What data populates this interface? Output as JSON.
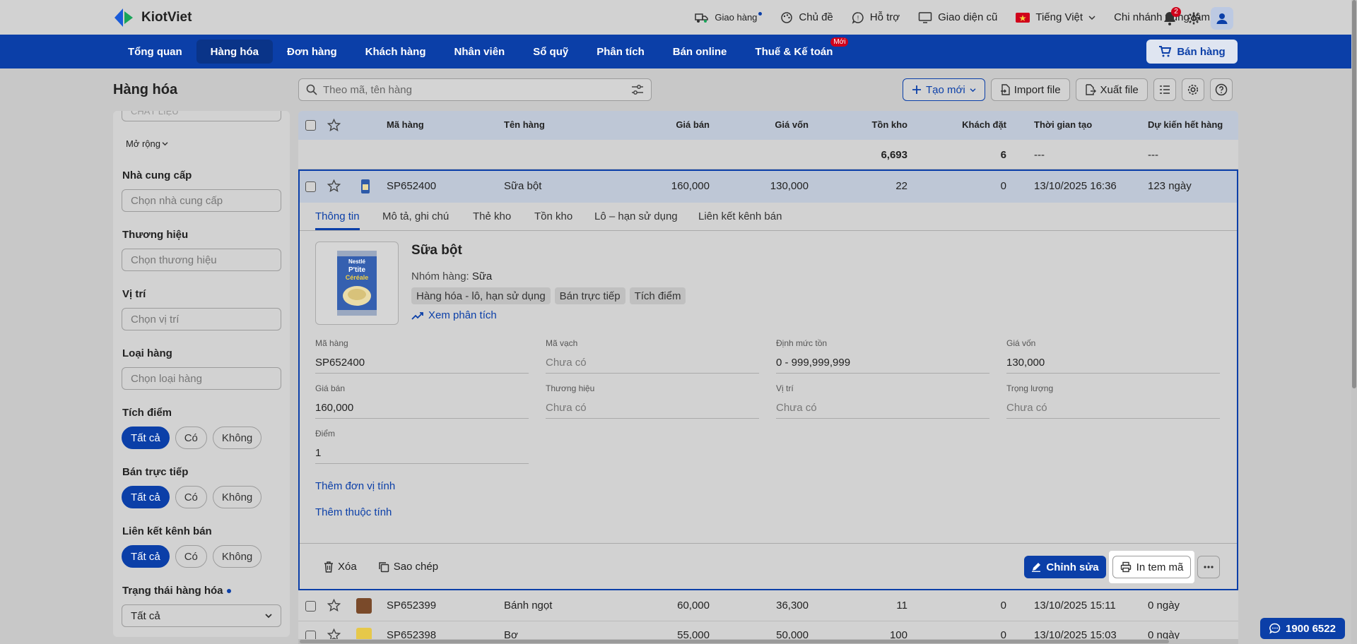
{
  "app": {
    "name": "KiotViet"
  },
  "topbar": {
    "delivery": "Giao hàng",
    "theme": "Chủ đề",
    "support": "Hỗ trợ",
    "old_ui": "Giao diện cũ",
    "language": "Tiếng Việt",
    "branch": "Chi nhánh trung tâm",
    "notif_count": "2"
  },
  "nav": {
    "items": [
      {
        "label": "Tổng quan"
      },
      {
        "label": "Hàng hóa"
      },
      {
        "label": "Đơn hàng"
      },
      {
        "label": "Khách hàng"
      },
      {
        "label": "Nhân viên"
      },
      {
        "label": "Sổ quỹ"
      },
      {
        "label": "Phân tích"
      },
      {
        "label": "Bán online"
      },
      {
        "label": "Thuế & Kế toán"
      }
    ],
    "new_badge": "Mới",
    "sell_button": "Bán hàng"
  },
  "page": {
    "title": "Hàng hóa"
  },
  "search": {
    "placeholder": "Theo mã, tên hàng"
  },
  "actions": {
    "create": "Tạo mới",
    "import": "Import file",
    "export": "Xuất file"
  },
  "sidebar": {
    "material_cut": "CHẤT LIỆU",
    "expand": "Mở rộng",
    "supplier_label": "Nhà cung cấp",
    "supplier_ph": "Chọn nhà cung cấp",
    "brand_label": "Thương hiệu",
    "brand_ph": "Chọn thương hiệu",
    "location_label": "Vị trí",
    "location_ph": "Chọn vị trí",
    "type_label": "Loại hàng",
    "type_ph": "Chọn loại hàng",
    "points_label": "Tích điểm",
    "direct_label": "Bán trực tiếp",
    "channel_label": "Liên kết kênh bán",
    "status_label": "Trạng thái hàng hóa",
    "status_value": "Tất cả",
    "chip_all": "Tất cả",
    "chip_yes": "Có",
    "chip_no": "Không"
  },
  "table": {
    "columns": [
      "Mã hàng",
      "Tên hàng",
      "Giá bán",
      "Giá vốn",
      "Tồn kho",
      "Khách đặt",
      "Thời gian tạo",
      "Dự kiến hết hàng"
    ],
    "summary": {
      "stock": "6,693",
      "ordered": "6",
      "created": "---",
      "eta": "---"
    },
    "rows": [
      {
        "code": "SP652400",
        "name": "Sữa bột",
        "price": "160,000",
        "cost": "130,000",
        "stock": "22",
        "ordered": "0",
        "created": "13/10/2025 16:36",
        "eta": "123 ngày"
      },
      {
        "code": "SP652399",
        "name": "Bánh ngọt",
        "price": "60,000",
        "cost": "36,300",
        "stock": "11",
        "ordered": "0",
        "created": "13/10/2025 15:11",
        "eta": "0 ngày"
      },
      {
        "code": "SP652398",
        "name": "Bơ",
        "price": "55,000",
        "cost": "50,000",
        "stock": "100",
        "ordered": "0",
        "created": "13/10/2025 15:03",
        "eta": "0 ngày"
      }
    ]
  },
  "detail": {
    "tabs": [
      "Thông tin",
      "Mô tả, ghi chú",
      "Thẻ kho",
      "Tồn kho",
      "Lô – hạn sử dụng",
      "Liên kết kênh bán"
    ],
    "name": "Sữa bột",
    "group_label": "Nhóm hàng:",
    "group_value": "Sữa",
    "tags": [
      "Hàng hóa - lô, hạn sử dụng",
      "Bán trực tiếp",
      "Tích điểm"
    ],
    "analysis_link": "Xem phân tích",
    "image_text": {
      "brand": "Nestlé",
      "line1": "P'tite",
      "line2": "Céréale"
    },
    "fields": [
      {
        "label": "Mã hàng",
        "value": "SP652400"
      },
      {
        "label": "Mã vạch",
        "value": "Chưa có"
      },
      {
        "label": "Định mức tồn",
        "value": "0 - 999,999,999"
      },
      {
        "label": "Giá vốn",
        "value": "130,000"
      },
      {
        "label": "Giá bán",
        "value": "160,000"
      },
      {
        "label": "Thương hiệu",
        "value": "Chưa có"
      },
      {
        "label": "Vị trí",
        "value": "Chưa có"
      },
      {
        "label": "Trọng lượng",
        "value": "Chưa có"
      },
      {
        "label": "Điểm",
        "value": "1"
      }
    ],
    "add_unit": "Thêm đơn vị tính",
    "add_attr": "Thêm thuộc tính",
    "delete": "Xóa",
    "copy": "Sao chép",
    "edit": "Chỉnh sửa",
    "print": "In tem mã"
  },
  "hotline": "1900 6522",
  "colors": {
    "brand": "#0b3fa8",
    "badge": "#d0021b"
  }
}
